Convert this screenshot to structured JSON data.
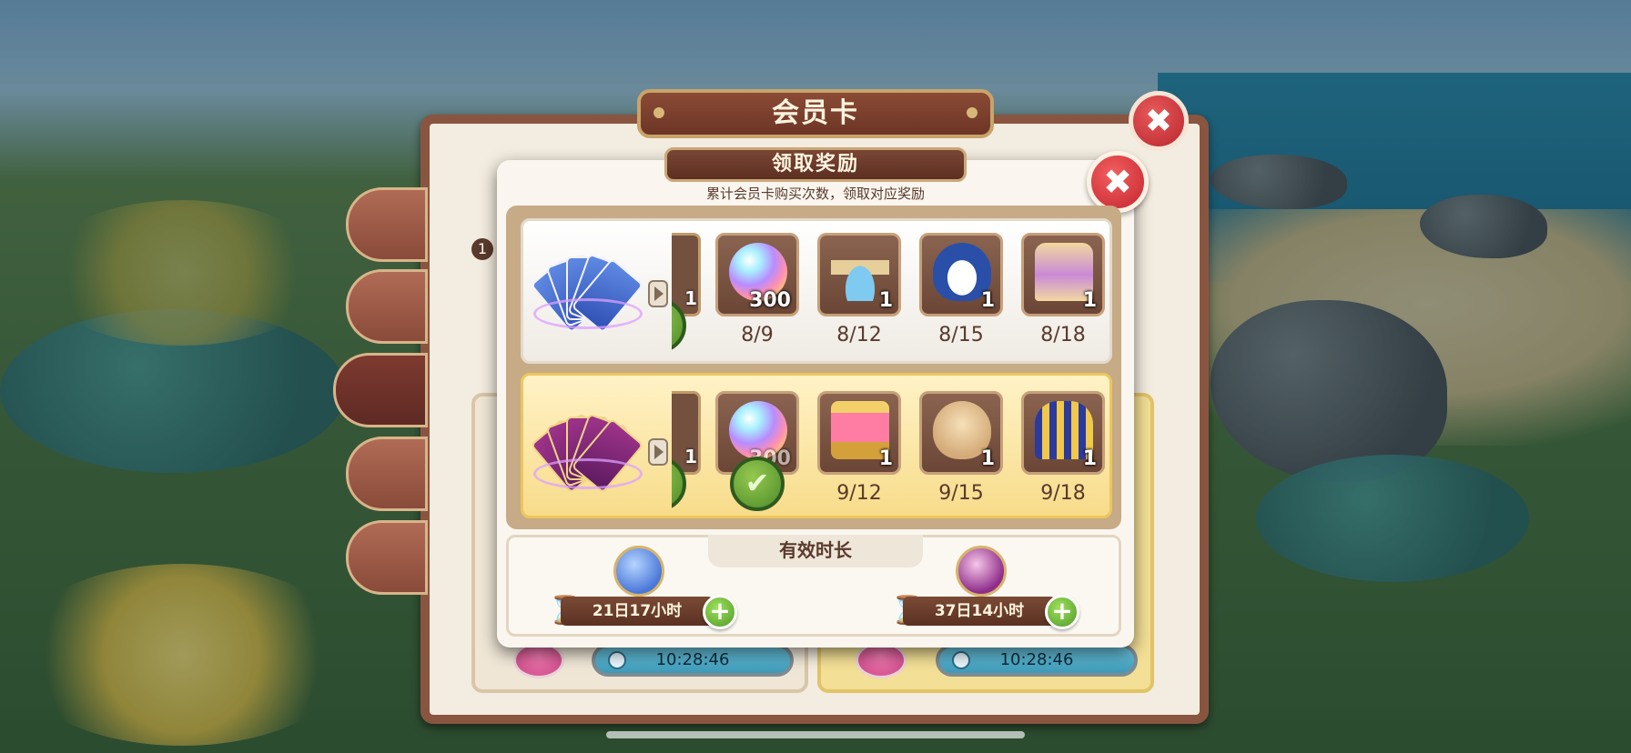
{
  "back_panel": {
    "title": "会员卡",
    "close_label": "✖",
    "card_badge": "1",
    "timers": [
      "10:28:46",
      "10:28:46"
    ]
  },
  "dialog": {
    "title": "领取奖励",
    "subtitle": "累计会员卡购买次数，领取对应奖励",
    "close_label": "✖"
  },
  "rows": [
    {
      "tier": "blue",
      "partial_qty": "1",
      "items": [
        {
          "icon": "rainbow-orb-icon",
          "qty": "300",
          "label": "8/9",
          "claimed": false
        },
        {
          "icon": "fountain-icon",
          "qty": "1",
          "label": "8/12",
          "claimed": false
        },
        {
          "icon": "penguin-icon",
          "qty": "1",
          "label": "8/15",
          "claimed": false
        },
        {
          "icon": "costume-icon",
          "qty": "1",
          "label": "8/18",
          "claimed": false
        }
      ]
    },
    {
      "tier": "gold",
      "partial_qty": "1",
      "items": [
        {
          "icon": "rainbow-orb-icon",
          "qty": "300",
          "label": "",
          "claimed": true
        },
        {
          "icon": "bed-icon",
          "qty": "1",
          "label": "9/12",
          "claimed": false
        },
        {
          "icon": "seal-icon",
          "qty": "1",
          "label": "9/15",
          "claimed": false
        },
        {
          "icon": "pharaoh-costume-icon",
          "qty": "1",
          "label": "9/18",
          "claimed": false
        }
      ]
    }
  ],
  "duration": {
    "title": "有效时长",
    "blue_time": "21日17小时",
    "gold_time": "37日14小时",
    "plus_label": "+",
    "hourglass_icon": "⌛"
  },
  "icons": {
    "arrow": "chevron-right-icon",
    "check": "✔"
  },
  "colors": {
    "accent_brown": "#7a4634",
    "claim_green": "#4e8a2a",
    "close_red": "#c4252f"
  }
}
